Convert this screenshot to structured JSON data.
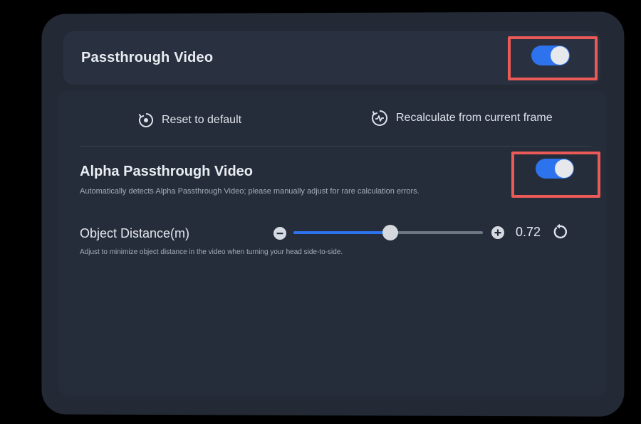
{
  "passthrough": {
    "title": "Passthrough Video",
    "enabled": true
  },
  "actions": {
    "reset_label": "Reset to default",
    "reset_icon": "reset-circle-icon",
    "recalc_label": "Recalculate from current frame",
    "recalc_icon": "recalculate-icon"
  },
  "alpha": {
    "title": "Alpha Passthrough Video",
    "description": "Automatically detects Alpha Passthrough Video; please manually adjust for rare calculation errors.",
    "enabled": true
  },
  "distance": {
    "label": "Object Distance(m)",
    "value": "0.72",
    "slider_fraction": 0.51,
    "description": "Adjust to minimize object distance in the video when turning your head side-to-side.",
    "minus_icon": "minus-icon",
    "plus_icon": "plus-icon",
    "reset_icon": "undo-icon"
  },
  "colors": {
    "accent": "#2e73ee",
    "highlight": "#ec5a57",
    "panel": "#232a35"
  }
}
